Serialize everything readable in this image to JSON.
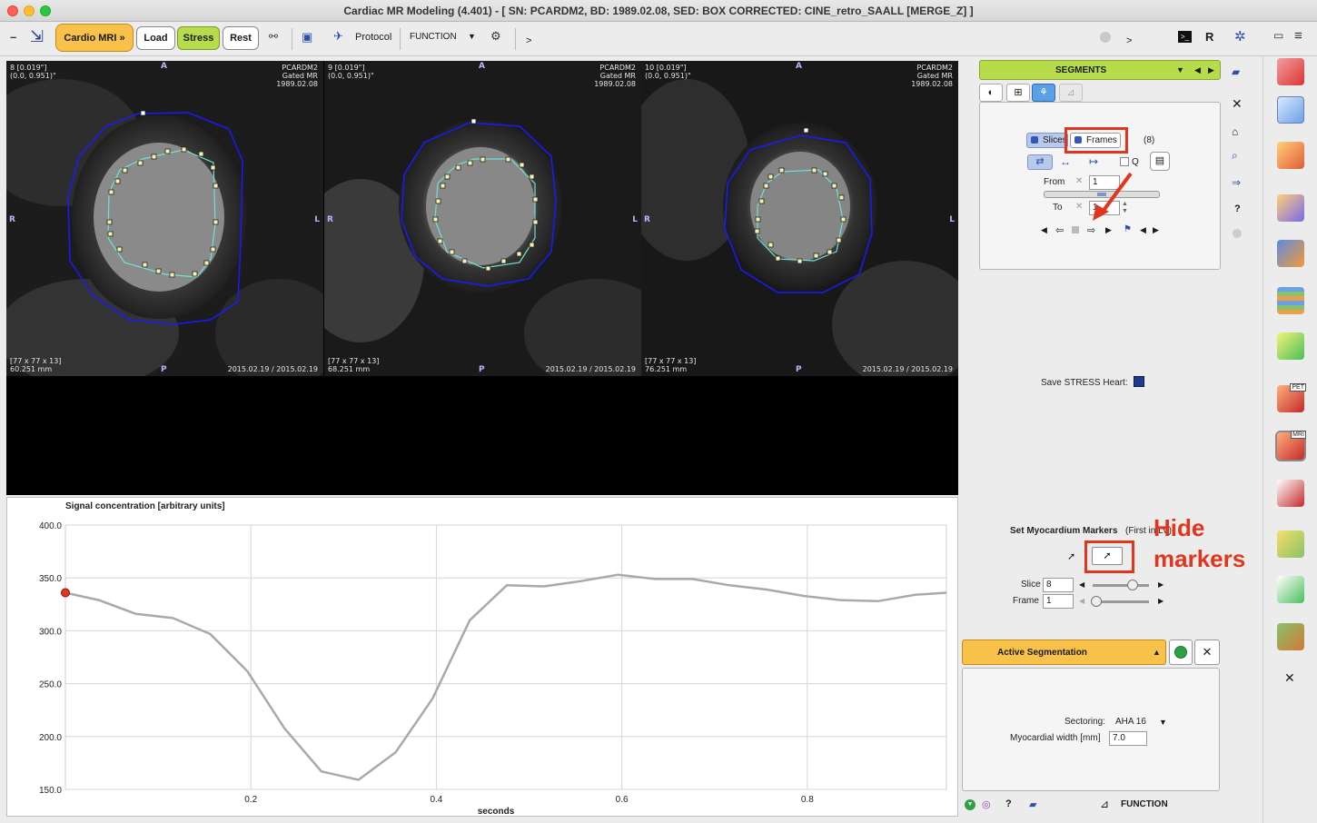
{
  "window": {
    "title": "Cardiac MR Modeling (4.401) - [ SN: PCARDM2, BD: 1989.02.08, SED: BOX CORRECTED: CINE_retro_SAALL  [MERGE_Z] ]"
  },
  "toolbar": {
    "cardio_mri": "Cardio MRI »",
    "load": "Load",
    "stress": "Stress",
    "rest": "Rest",
    "protocol": "Protocol",
    "function": "FUNCTION",
    "more": ">",
    "more2": ">",
    "r_label": "R"
  },
  "viewers": [
    {
      "slice": "8 [0.019\"]",
      "coords": "(0.0, 0.951)\"",
      "patient": "PCARDM2",
      "modality": "Gated MR",
      "date": "1989.02.08",
      "dims": "[77 x 77 x 13]",
      "pos": "60.251 mm",
      "study": "2015.02.19 / 2015.02.19",
      "top": "A",
      "bottom": "P",
      "left": "R",
      "right": "L"
    },
    {
      "slice": "9 [0.019\"]",
      "coords": "(0.0, 0.951)\"",
      "patient": "PCARDM2",
      "modality": "Gated MR",
      "date": "1989.02.08",
      "dims": "[77 x 77 x 13]",
      "pos": "68.251 mm",
      "study": "2015.02.19 / 2015.02.19",
      "top": "A",
      "bottom": "P",
      "left": "R",
      "right": "L"
    },
    {
      "slice": "10 [0.019\"]",
      "coords": "(0.0, 0.951)\"",
      "patient": "PCARDM2",
      "modality": "Gated MR",
      "date": "1989.02.08",
      "dims": "[77 x 77 x 13]",
      "pos": "76.251 mm",
      "study": "2015.02.19 / 2015.02.19",
      "top": "A",
      "bottom": "P",
      "left": "R",
      "right": "L"
    }
  ],
  "segments": {
    "header": "SEGMENTS",
    "slices_label": "Slices",
    "frames_label": "Frames",
    "count": "(8)",
    "q_label": "Q",
    "from_label": "From",
    "from_value": "1",
    "to_label": "To",
    "to_value": "1",
    "save_label": "Save STRESS Heart:"
  },
  "markers": {
    "title": "Set Myocardium Markers",
    "subtitle": "(First in LV)",
    "annotation": "Hide markers",
    "slice_label": "Slice",
    "slice_value": "8",
    "frame_label": "Frame",
    "frame_value": "1"
  },
  "active_segmentation": {
    "title": "Active Segmentation",
    "sectoring_label": "Sectoring:",
    "sectoring_value": "AHA 16",
    "width_label": "Myocardial width [mm]",
    "width_value": "7.0"
  },
  "footer": {
    "function_label": "FUNCTION"
  },
  "sidebar": {
    "icons": [
      "exit-icon",
      "kinetic-model-icon",
      "pet-mr-icon",
      "ruler-icon",
      "puzzle-icon",
      "bars-icon",
      "rocket-icon",
      "cardiac-pet-icon",
      "cardiac-mri-icon",
      "heart-icon",
      "brain-icon",
      "lab-icon",
      "layers-icon",
      "close-icon"
    ],
    "pet_badge": "PET",
    "mri_badge": "MRI"
  },
  "colors": {
    "accent_yellow": "#f7c14a",
    "accent_green": "#b6dc4c",
    "contour_blue": "#1a1aff",
    "contour_cyan": "#6fe3d5",
    "annotation_red": "#e0361d"
  },
  "chart_data": {
    "type": "line",
    "title": "Signal concentration [arbitrary units]",
    "xlabel": "seconds",
    "ylabel": "",
    "xlim": [
      0.0,
      0.95
    ],
    "ylim": [
      150.0,
      400.0
    ],
    "x_ticks": [
      "0.2",
      "0.4",
      "0.6",
      "0.8"
    ],
    "y_ticks": [
      "400.0",
      "350.0",
      "300.0",
      "250.0",
      "200.0",
      "150.0"
    ],
    "grid": true,
    "series": [
      {
        "x": [
          0.0,
          0.036,
          0.076,
          0.116,
          0.156,
          0.196,
          0.236,
          0.276,
          0.316,
          0.356,
          0.396,
          0.436,
          0.476,
          0.516,
          0.556,
          0.596,
          0.636,
          0.676,
          0.716,
          0.756,
          0.796,
          0.836,
          0.876,
          0.916,
          0.95
        ],
        "values": [
          336,
          329,
          316,
          312,
          297,
          262,
          208,
          167,
          159,
          185,
          236,
          310,
          343,
          342,
          347,
          353,
          349,
          349,
          343,
          339,
          333,
          329,
          328,
          334,
          336
        ]
      }
    ],
    "highlight_point": {
      "x": 0.0,
      "y": 336
    }
  }
}
